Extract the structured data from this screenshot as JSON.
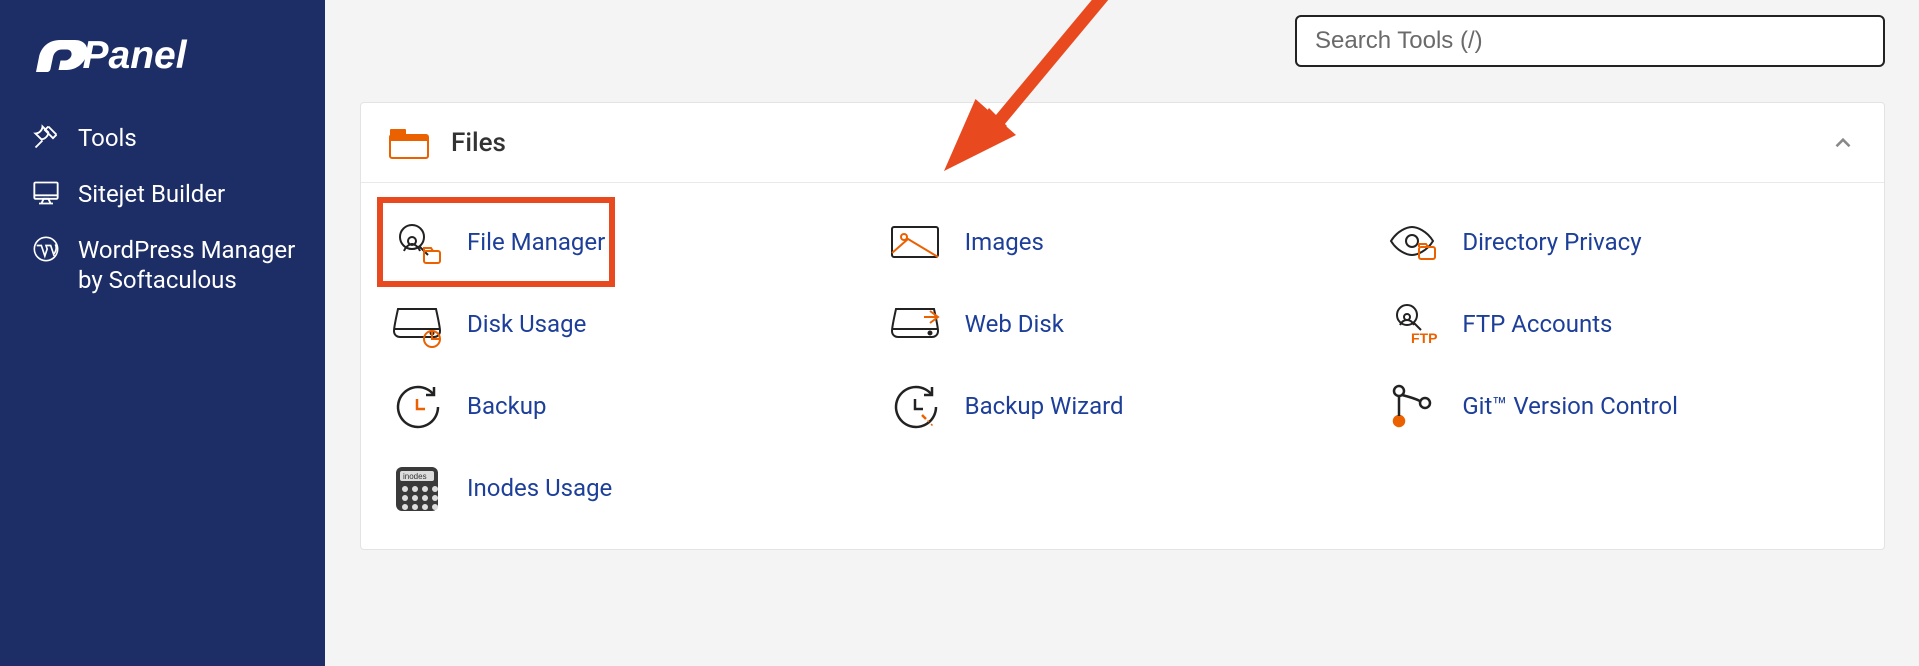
{
  "brand": "cPanel",
  "search": {
    "placeholder": "Search Tools (/)"
  },
  "sidebar": {
    "items": [
      {
        "label": "Tools"
      },
      {
        "label": "Sitejet Builder"
      },
      {
        "label": "WordPress Manager by Softaculous"
      }
    ]
  },
  "panel": {
    "title": "Files",
    "tools": [
      {
        "label": "File Manager"
      },
      {
        "label": "Images"
      },
      {
        "label": "Directory Privacy"
      },
      {
        "label": "Disk Usage"
      },
      {
        "label": "Web Disk"
      },
      {
        "label": "FTP Accounts"
      },
      {
        "label": "Backup"
      },
      {
        "label": "Backup Wizard"
      },
      {
        "label": "Git™ Version Control"
      },
      {
        "label": "Inodes Usage"
      }
    ]
  },
  "annotation": {
    "points_to": "file-manager-link"
  },
  "colors": {
    "sidebar_bg": "#1d2d65",
    "link": "#1d3f99",
    "accent": "#eb6100",
    "highlight": "#e8491f"
  }
}
